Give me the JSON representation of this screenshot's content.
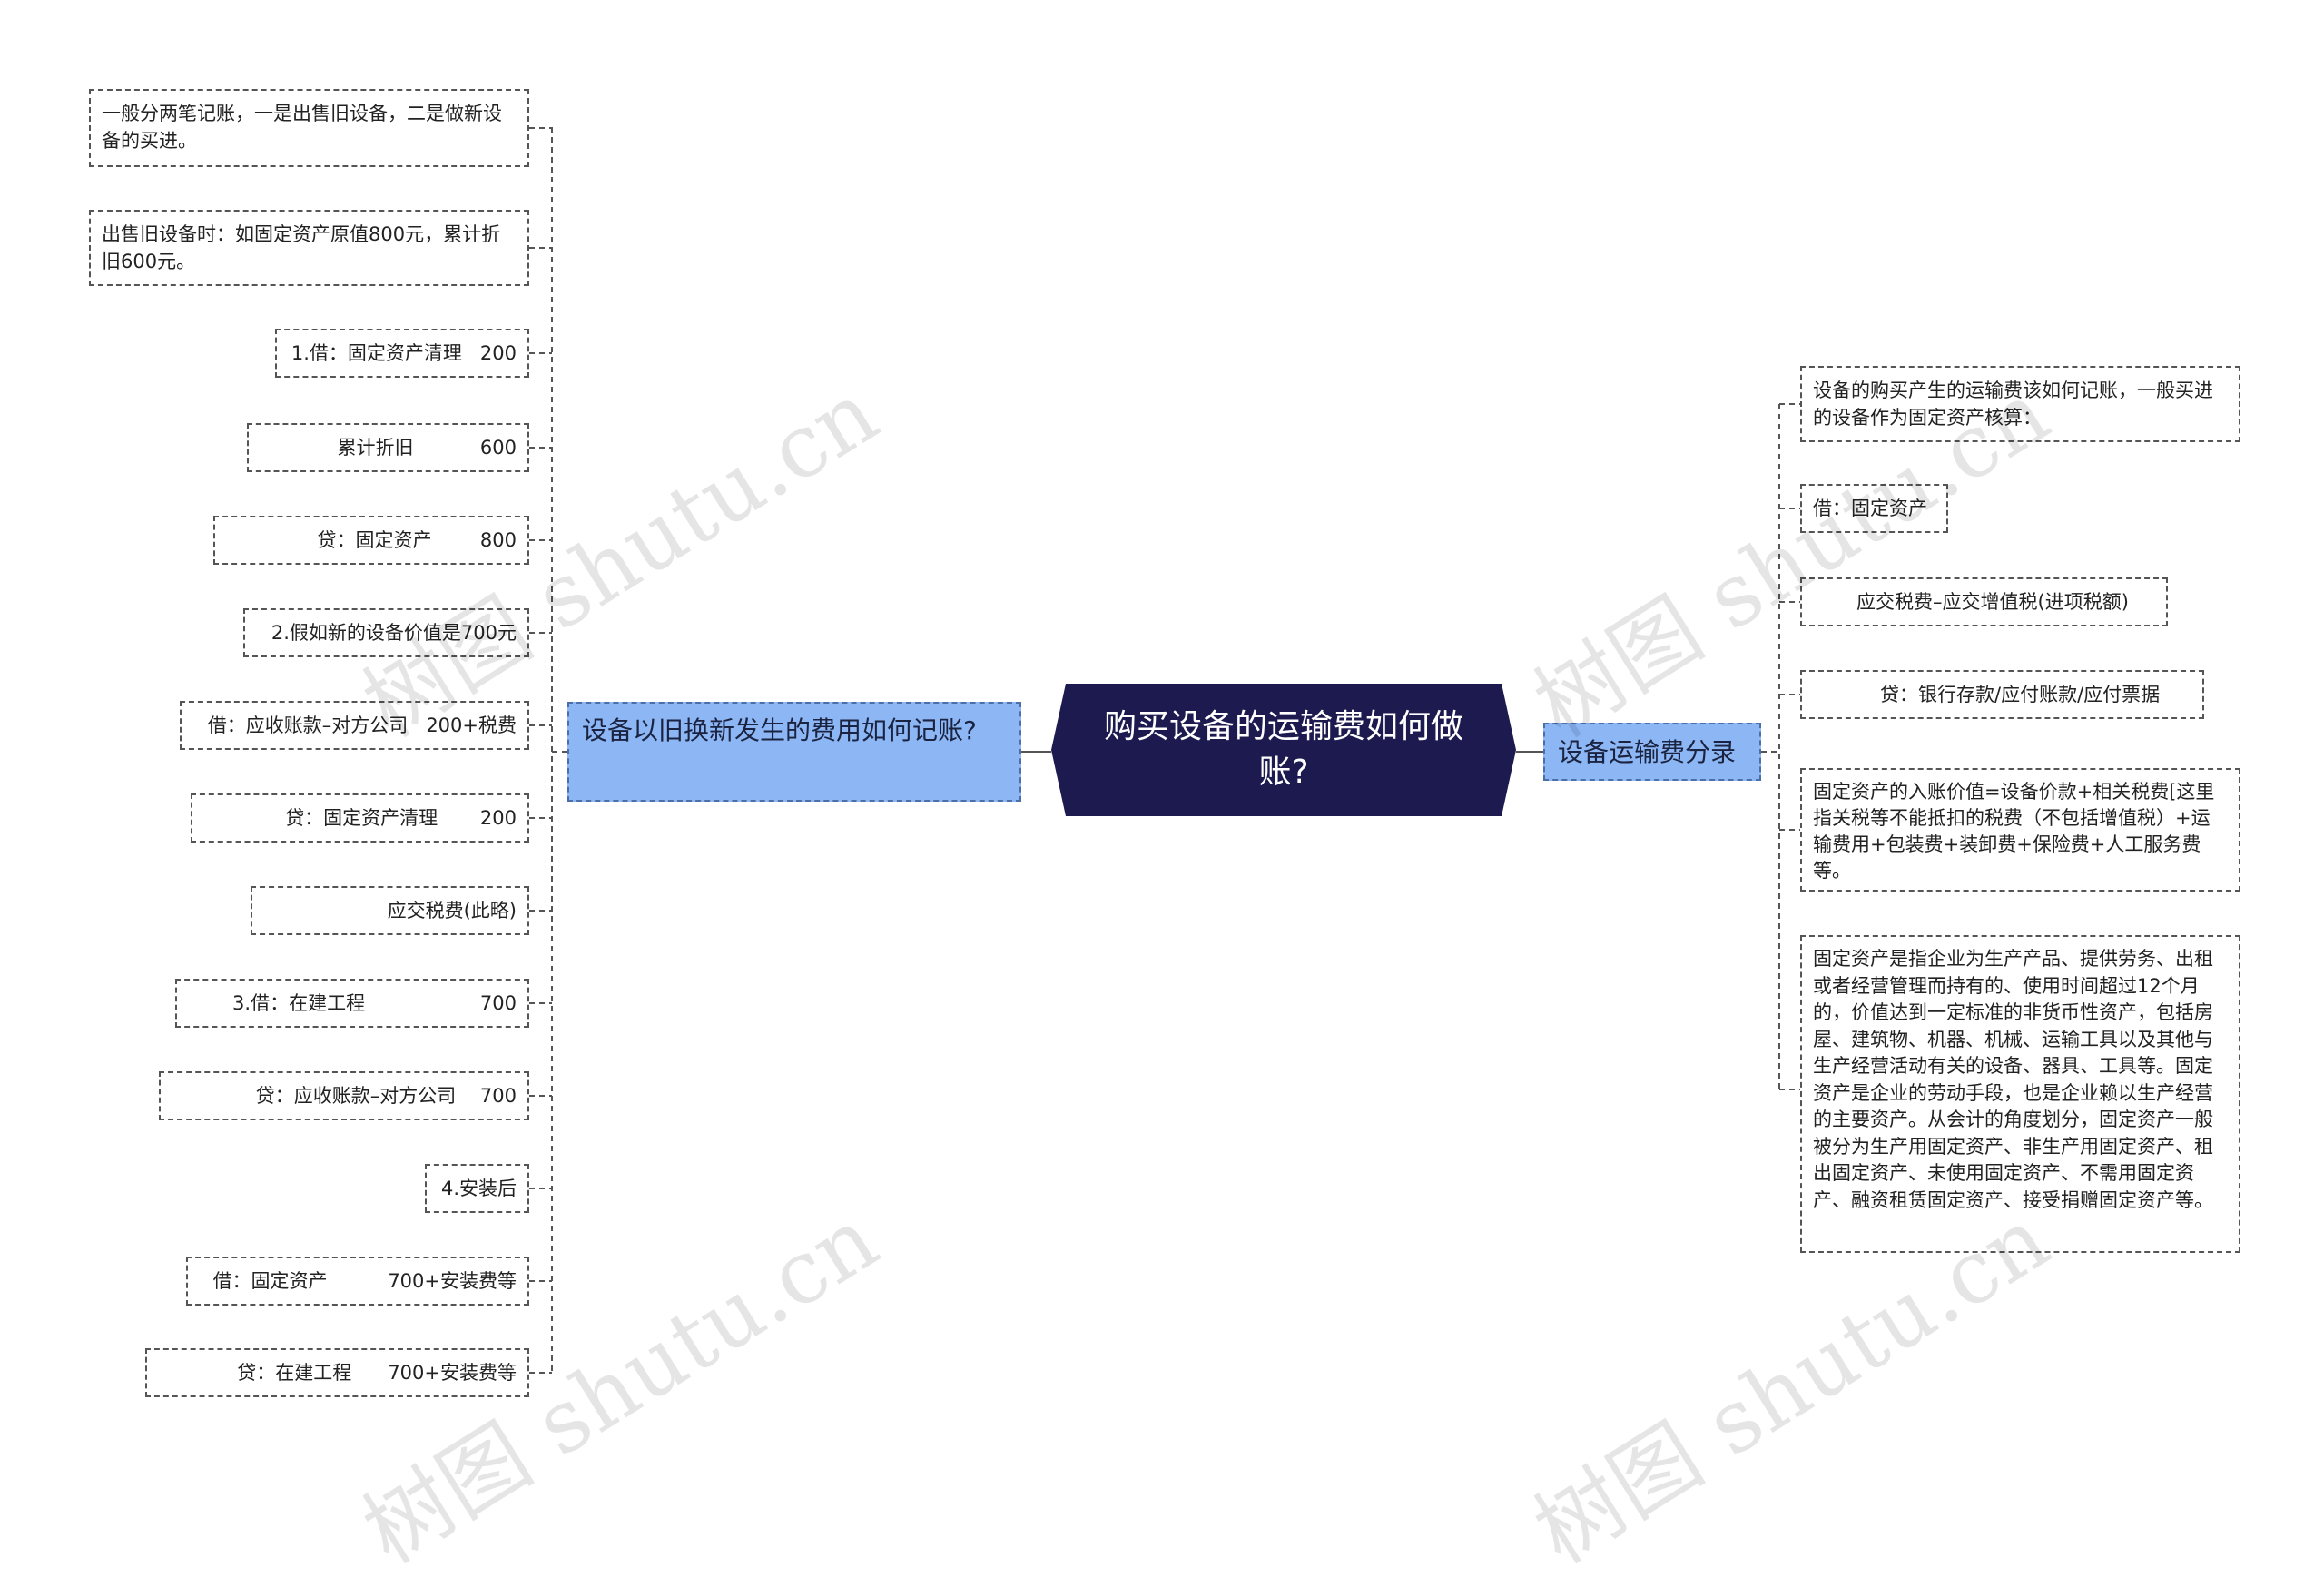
{
  "root": {
    "text": "购买设备的运输费如何做账?"
  },
  "left_branch": {
    "label": "设备以旧换新发生的费用如何记账?",
    "items": [
      "一般分两笔记账，一是出售旧设备，二是做新设备的买进。",
      "出售旧设备时：如固定资产原值800元，累计折旧600元。",
      "1.借：固定资产清理   200",
      "累计折旧           600",
      "贷：固定资产        800",
      "2.假如新的设备价值是700元",
      "借：应收账款–对方公司   200+税费",
      "贷：固定资产清理       200",
      "应交税费(此略)",
      "3.借：在建工程                   700",
      "贷：应收账款–对方公司    700",
      "4.安装后",
      "借：固定资产          700+安装费等",
      "贷：在建工程      700+安装费等"
    ]
  },
  "right_branch": {
    "label": "设备运输费分录",
    "items": [
      "设备的购买产生的运输费该如何记账，一般买进的设备作为固定资产核算：",
      "借：固定资产",
      "应交税费–应交增值税(进项税额)",
      "贷：银行存款/应付账款/应付票据",
      "固定资产的入账价值=设备价款+相关税费[这里指关税等不能抵扣的税费（不包括增值税）+运输费用+包装费+装卸费+保险费+人工服务费等。",
      "固定资产是指企业为生产产品、提供劳务、出租或者经营管理而持有的、使用时间超过12个月的，价值达到一定标准的非货币性资产，包括房屋、建筑物、机器、机械、运输工具以及其他与生产经营活动有关的设备、器具、工具等。固定资产是企业的劳动手段，也是企业赖以生产经营的主要资产。从会计的角度划分，固定资产一般被分为生产用固定资产、非生产用固定资产、租出固定资产、未使用固定资产、不需用固定资产、融资租赁固定资产、接受捐赠固定资产等。"
    ]
  },
  "watermark": "树图 shutu.cn",
  "colors": {
    "root_bg": "#1c1a4f",
    "branch_bg": "#8db6f5",
    "line": "#555555"
  }
}
